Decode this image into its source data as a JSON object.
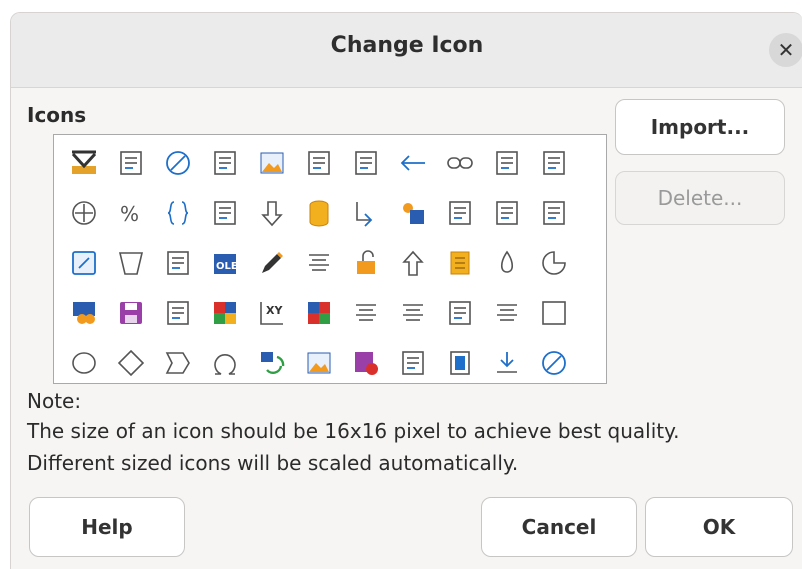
{
  "dialog": {
    "title": "Change Icon",
    "close_icon": "close-icon"
  },
  "icons_section": {
    "label": "Icons",
    "grid_rows": 5,
    "grid_cols": 11,
    "icon_names": [
      [
        "mark-icon",
        "frame-grid-icon",
        "forbidden-icon",
        "table-properties-icon",
        "image-icon",
        "frame-select-icon",
        "paste-special-icon",
        "arrow-left-icon",
        "link-icon",
        "resize-horizontal-icon",
        "fontwork-icon"
      ],
      [
        "move-cross-icon",
        "percent-icon",
        "braces-icon",
        "column-icon",
        "arrow-down-icon",
        "cylinder-icon",
        "insert-object-icon",
        "highlight-icon",
        "rotate-icon",
        "cube-icon",
        "distribute-icon"
      ],
      [
        "edit-frame-icon",
        "trapezoid-icon",
        "arc-icon",
        "ole-object-icon",
        "edit-pencil-icon",
        "align-lines-icon",
        "unlock-icon",
        "arrow-up-icon",
        "notes-icon",
        "drop-icon",
        "pie-icon"
      ],
      [
        "database-icon",
        "save-icon",
        "inset-frame-icon",
        "color-palette-icon",
        "xy-chart-icon",
        "mosaic-icon",
        "align-center-icon",
        "page-icon",
        "calendar-icon",
        "align-right-icon",
        "square-icon"
      ],
      [
        "ellipse-icon",
        "diamond-icon",
        "chevron-shape-icon",
        "omega-icon",
        "refresh-image-icon",
        "picture-icon",
        "record-macro-icon",
        "document-icon",
        "column-break-icon",
        "download-icon",
        "no-fill-icon"
      ]
    ]
  },
  "buttons": {
    "import": "Import...",
    "delete": "Delete...",
    "help": "Help",
    "cancel": "Cancel",
    "ok": "OK"
  },
  "note": {
    "title": "Note:",
    "line1": "The size of an icon should be 16x16 pixel to achieve best quality.",
    "line2": "Different sized icons will be scaled automatically."
  },
  "colors": {
    "dialog_bg": "#f6f5f4",
    "titlebar_bg": "#ebebeb",
    "icon_blue": "#1e6fc9",
    "icon_gray": "#555555"
  }
}
